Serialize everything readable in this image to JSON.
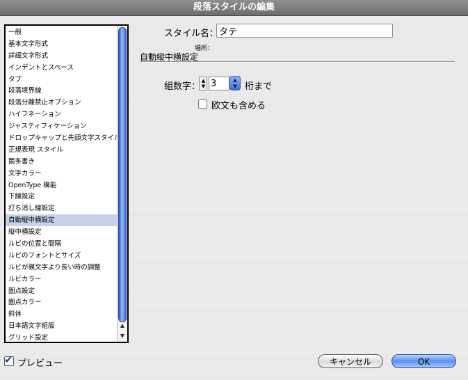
{
  "window": {
    "title": "段落スタイルの編集"
  },
  "sidebar": {
    "items": [
      "一般",
      "基本文字形式",
      "詳細文字形式",
      "インデントとスペース",
      "タブ",
      "段落境界線",
      "段落分離禁止オプション",
      "ハイフネーション",
      "ジャスティフィケーション",
      "ドロップキャップと先頭文字スタイル",
      "正規表現 スタイル",
      "箇条書き",
      "文字カラー",
      "OpenType 機能",
      "下線設定",
      "打ち消し線設定",
      "自動縦中横設定",
      "縦中横設定",
      "ルビの位置と間隔",
      "ルビのフォントとサイズ",
      "ルビが親文字より長い時の調整",
      "ルビカラー",
      "圏点設定",
      "圏点カラー",
      "斜体",
      "日本語文字組版",
      "グリッド設定"
    ],
    "selected_index": 16
  },
  "form": {
    "style_name_label": "スタイル名：",
    "style_name_value": "タテ",
    "location_label": "場所：",
    "section_title": "自動縦中横設定",
    "kumi_label": "組数字：",
    "kumi_value": "3",
    "kumi_suffix": "桁まで",
    "obun_label": "欧文も含める",
    "obun_checked": false
  },
  "footer": {
    "preview_label": "プレビュー",
    "preview_checked": true,
    "cancel_label": "キャンセル",
    "ok_label": "OK"
  },
  "icons": {
    "preview_check": "check-icon",
    "scroll_up": "scroll-up-arrow-icon",
    "scroll_down": "scroll-down-arrow-icon"
  },
  "colors": {
    "selection": "#c5d2ea",
    "accent": "#5c8ff0",
    "titlebar": "#7d7d7d"
  }
}
